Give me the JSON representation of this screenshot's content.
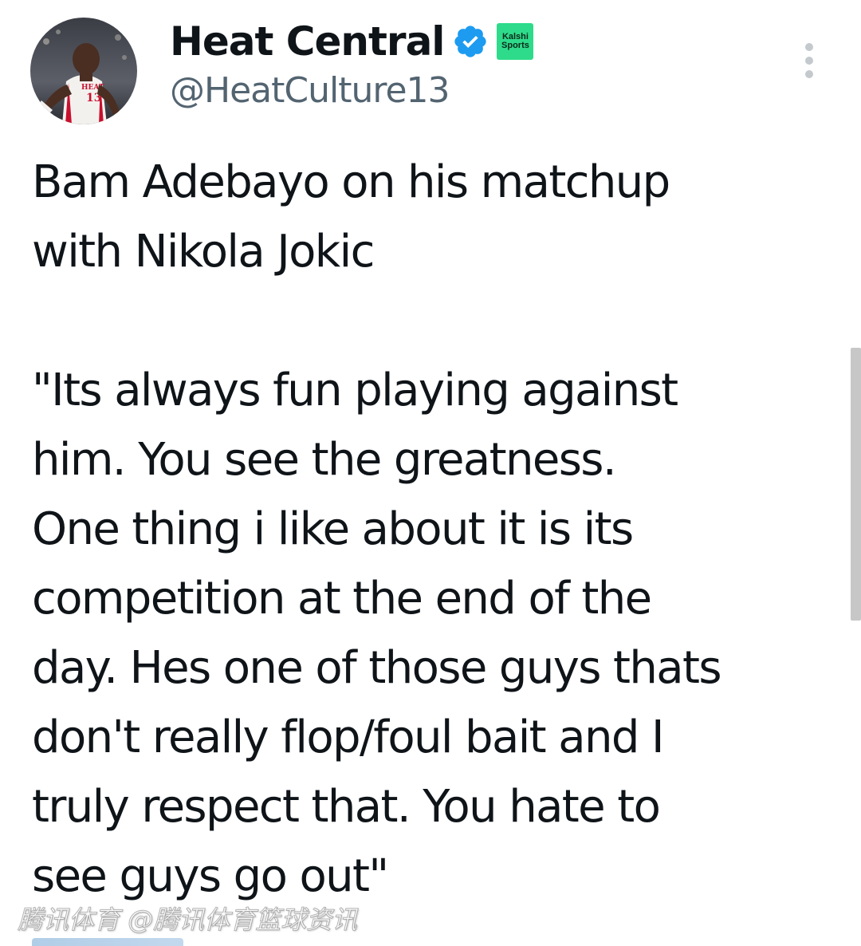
{
  "tweet": {
    "author": {
      "display_name": "Heat Central",
      "handle": "@HeatCulture13",
      "verified_icon": "verified-check-icon",
      "affiliate_badge": {
        "line1": "Kalshi",
        "line2": "Sports"
      }
    },
    "text": "Bam Adebayo on his matchup\nwith Nikola Jokic\n\n\"Its always fun playing against\nhim. You see the greatness.\nOne thing i like about it is its\ncompetition at the end of the\nday. Hes one of those guys thats\ndon't really flop/foul bait and I\ntruly respect that. You hate to\nsee guys go out\"",
    "more_icon": "more-vertical-icon"
  },
  "watermark": {
    "text": "腾讯体育 @腾讯体育篮球资讯"
  },
  "colors": {
    "verified_blue": "#1d9bf0",
    "affiliate_green": "#2edb8a",
    "handle_gray": "#536471",
    "text": "#0f1419"
  }
}
